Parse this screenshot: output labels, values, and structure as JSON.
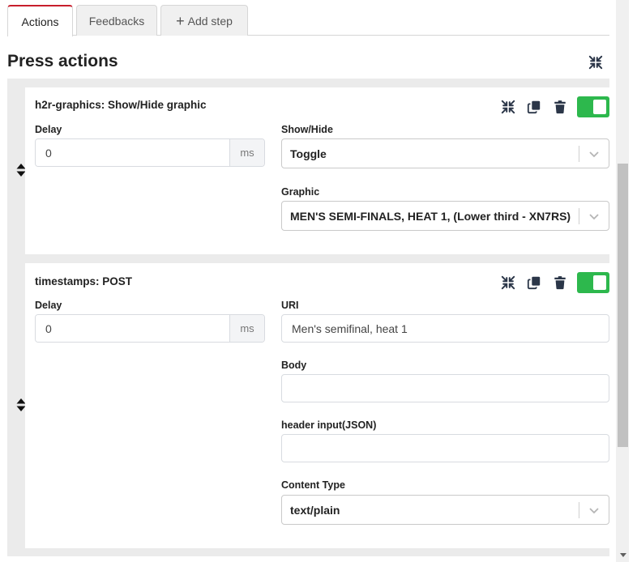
{
  "tabs": [
    {
      "label": "Actions",
      "active": true
    },
    {
      "label": "Feedbacks",
      "active": false
    },
    {
      "label": "Add step",
      "active": false
    }
  ],
  "section": {
    "title": "Press actions"
  },
  "colors": {
    "accent": "#c81e2c",
    "toggle_on": "#2db84d",
    "icon": "#2b3648"
  },
  "icons": {
    "collapse": "collapse-arrows-icon",
    "copy": "copy-icon",
    "delete": "trash-icon",
    "drag": "drag-handle-icon",
    "chevron": "chevron-down-icon"
  },
  "actions": [
    {
      "title": "h2r-graphics: Show/Hide graphic",
      "enabled": true,
      "delay_label": "Delay",
      "delay_value": "0",
      "delay_unit": "ms",
      "fields": [
        {
          "label": "Show/Hide",
          "type": "select",
          "value": "Toggle"
        },
        {
          "label": "Graphic",
          "type": "select",
          "value": "MEN'S SEMI-FINALS, HEAT 1, (Lower third - XN7RS)"
        }
      ]
    },
    {
      "title": "timestamps: POST",
      "enabled": true,
      "delay_label": "Delay",
      "delay_value": "0",
      "delay_unit": "ms",
      "fields": [
        {
          "label": "URI",
          "type": "text",
          "value": "Men's semifinal, heat 1"
        },
        {
          "label": "Body",
          "type": "text",
          "value": ""
        },
        {
          "label": "header input(JSON)",
          "type": "text",
          "value": ""
        },
        {
          "label": "Content Type",
          "type": "select",
          "value": "text/plain"
        }
      ]
    }
  ]
}
